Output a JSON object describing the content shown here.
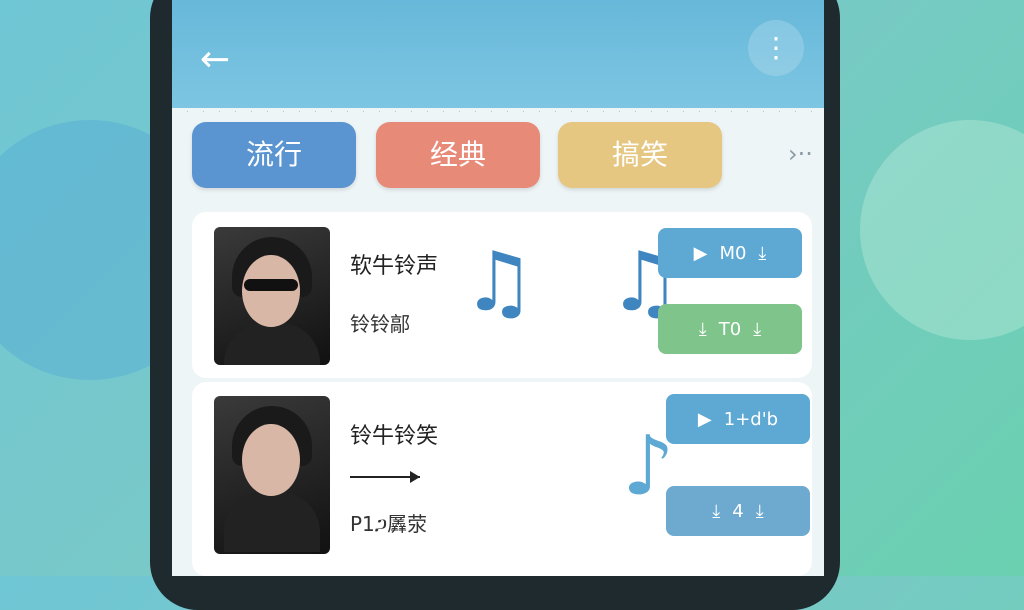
{
  "header": {
    "back_icon": "arrow-left-icon",
    "more_icon": "dots-vertical-icon",
    "accent": "#67b8da"
  },
  "tabs": [
    {
      "label": "流行",
      "color": "#5b95d1"
    },
    {
      "label": "经典",
      "color": "#e78a78"
    },
    {
      "label": "搞笑",
      "color": "#e6c782"
    }
  ],
  "tabs_more": "›··",
  "items": [
    {
      "title": "软牛铃声",
      "subtitle": "铃铃鄗",
      "play_label": "M0",
      "download_label": "T0"
    },
    {
      "title": "铃牛铃笑",
      "subtitle": "P1ጋ羼荥",
      "play_label": "1+d'b",
      "download_label": "4"
    }
  ]
}
